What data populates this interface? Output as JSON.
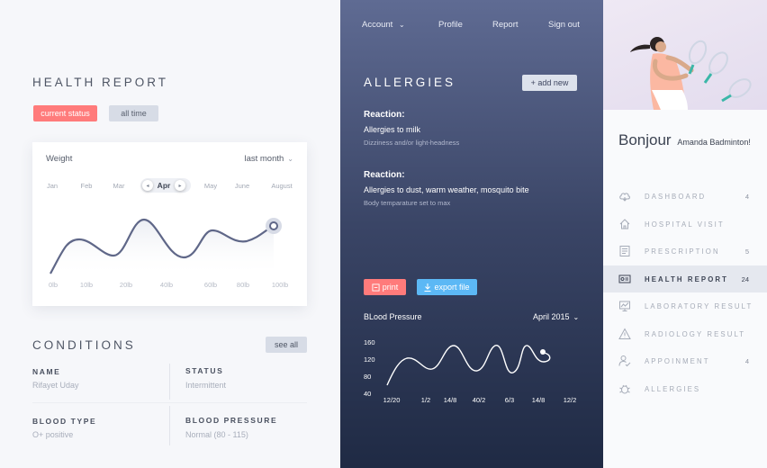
{
  "window": {
    "dot_colors": [
      "#ee5f56",
      "#f5bb2e",
      "#37c840"
    ]
  },
  "health": {
    "title": "HEALTH REPORT",
    "current_status_label": "current status",
    "all_time_label": "all time"
  },
  "weight": {
    "title": "Weight",
    "period": "last month",
    "months": [
      "Jan",
      "Feb",
      "Mar",
      "Apr",
      "May",
      "June",
      "August"
    ],
    "selected_month": "Apr",
    "x_labels": [
      "0lb",
      "10lb",
      "20lb",
      "40lb",
      "60lb",
      "80lb",
      "100lb"
    ]
  },
  "conditions": {
    "title": "CONDITIONS",
    "see_all_label": "see all",
    "fields": [
      {
        "label": "NAME",
        "value": "Rifayet Uday"
      },
      {
        "label": "STATUS",
        "value": "Intermittent"
      },
      {
        "label": "BLOOD TYPE",
        "value": "O+ positive"
      },
      {
        "label": "BLOOD PRESSURE",
        "value": "Normal (80 - 115)"
      }
    ]
  },
  "nav": {
    "account": "Account",
    "profile": "Profile",
    "report": "Report",
    "signout": "Sign out"
  },
  "allergies": {
    "title": "ALLERGIES",
    "add_new_label": "+ add new",
    "reactions": [
      {
        "heading": "Reaction:",
        "title": "Allergies to milk",
        "subtitle": "Dizziness and/or light-headness"
      },
      {
        "heading": "Reaction:",
        "title": "Allergies to dust, warm weather, mosquito bite",
        "subtitle": "Body temparature set to max"
      }
    ],
    "print_label": "print",
    "export_label": "export file"
  },
  "blood_pressure": {
    "title": "BLood Pressure",
    "period": "April 2015",
    "y_labels": [
      "160",
      "120",
      "80",
      "40"
    ],
    "x_labels": [
      "12/20",
      "1/2",
      "14/8",
      "40/2",
      "6/3",
      "14/8",
      "12/2"
    ]
  },
  "profile": {
    "greeting": "Bonjour",
    "name": "Amanda Badminton!"
  },
  "menu": [
    {
      "label": "DASHBOARD",
      "count": "4",
      "icon": "cloud-icon"
    },
    {
      "label": "HOSPITAL VISIT",
      "count": "",
      "icon": "home-icon"
    },
    {
      "label": "PRESCRIPTION",
      "count": "5",
      "icon": "document-icon"
    },
    {
      "label": "HEALTH REPORT",
      "count": "24",
      "icon": "id-card-icon",
      "active": true
    },
    {
      "label": "LABORATORY RESULT",
      "count": "",
      "icon": "chart-icon"
    },
    {
      "label": "RADIOLOGY RESULT",
      "count": "",
      "icon": "warning-icon"
    },
    {
      "label": "APPOINMENT",
      "count": "4",
      "icon": "user-check-icon"
    },
    {
      "label": "ALLERGIES",
      "count": "",
      "icon": "bug-icon"
    }
  ],
  "colors": {
    "accent_red": "#ff7b7b",
    "accent_blue": "#5cb8f5",
    "navy": "#2a3552"
  }
}
